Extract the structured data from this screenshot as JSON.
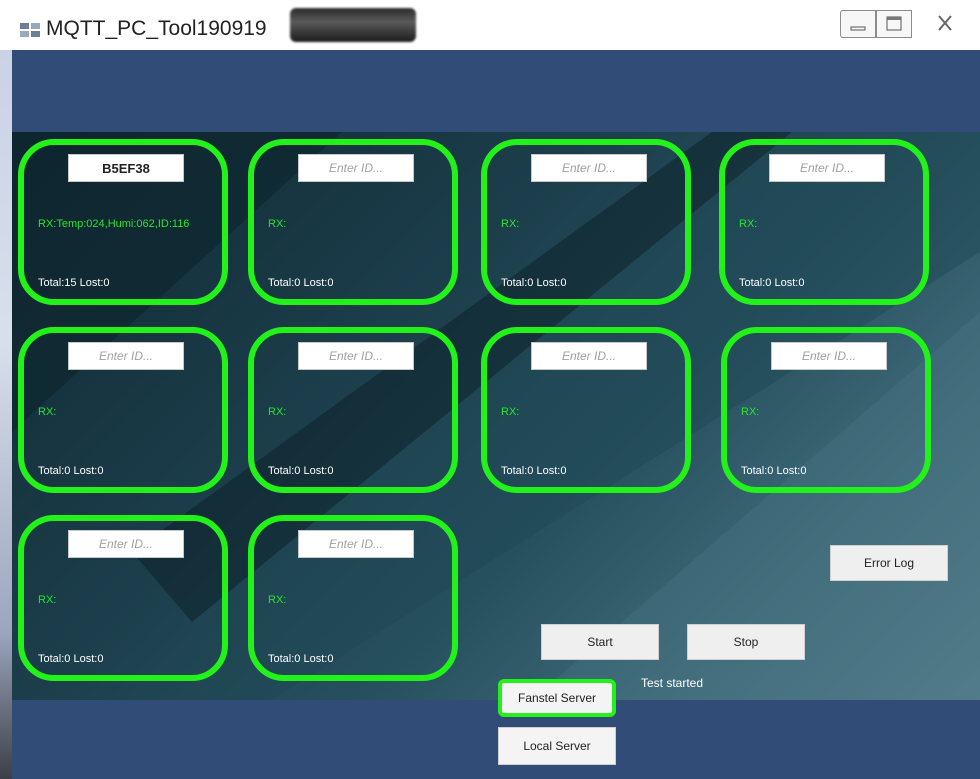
{
  "window": {
    "title": "MQTT_PC_Tool190919",
    "controls": [
      "minimize",
      "maximize",
      "close"
    ]
  },
  "devices": [
    {
      "id": "B5EF38",
      "placeholder": "Enter ID...",
      "rx": "RX:Temp:024,Humi:062,ID:116",
      "total": "Total:15 Lost:0"
    },
    {
      "id": "",
      "placeholder": "Enter ID...",
      "rx": "RX:",
      "total": "Total:0 Lost:0"
    },
    {
      "id": "",
      "placeholder": "Enter ID...",
      "rx": "RX:",
      "total": "Total:0 Lost:0"
    },
    {
      "id": "",
      "placeholder": "Enter ID...",
      "rx": "RX:",
      "total": "Total:0 Lost:0"
    },
    {
      "id": "",
      "placeholder": "Enter ID...",
      "rx": "RX:",
      "total": "Total:0 Lost:0"
    },
    {
      "id": "",
      "placeholder": "Enter ID...",
      "rx": "RX:",
      "total": "Total:0 Lost:0"
    },
    {
      "id": "",
      "placeholder": "Enter ID...",
      "rx": "RX:",
      "total": "Total:0 Lost:0"
    },
    {
      "id": "",
      "placeholder": "Enter ID...",
      "rx": "RX:",
      "total": "Total:0 Lost:0"
    },
    {
      "id": "",
      "placeholder": "Enter ID...",
      "rx": "RX:",
      "total": "Total:0 Lost:0"
    },
    {
      "id": "",
      "placeholder": "Enter ID...",
      "rx": "RX:",
      "total": "Total:0 Lost:0"
    }
  ],
  "buttons": {
    "error_log": "Error Log",
    "start": "Start",
    "stop": "Stop",
    "fanstel_server": "Fanstel Server",
    "local_server": "Local Server"
  },
  "status_text": "Test started",
  "colors": {
    "card_border": "#22f21a",
    "rx_text": "#27e52a",
    "header_band": "#314c76"
  }
}
